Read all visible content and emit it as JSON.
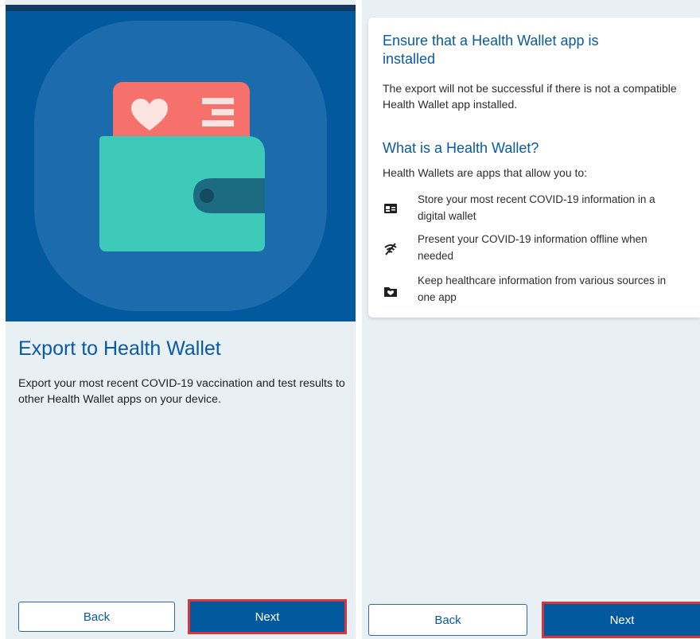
{
  "left_screen": {
    "title": "Export to Health Wallet",
    "description": "Export your most recent COVID-19 vaccination and test results to other Health Wallet apps on your device.",
    "back_label": "Back",
    "next_label": "Next"
  },
  "right_screen": {
    "ensure_heading": "Ensure that a Health Wallet app is installed",
    "ensure_text": "The export will not be successful if there is not a compatible Health Wallet app installed.",
    "what_heading": "What is a Health Wallet?",
    "intro": "Health Wallets are apps that allow you to:",
    "items": [
      {
        "icon": "id-card-icon",
        "text": "Store your most recent COVID-19 information in a digital wallet"
      },
      {
        "icon": "wifi-off-icon",
        "text": "Present your COVID-19 information offline when needed"
      },
      {
        "icon": "medical-folder-icon",
        "text": "Keep healthcare information from various sources in one app"
      }
    ],
    "back_label": "Back",
    "next_label": "Next"
  },
  "colors": {
    "primary": "#03599d",
    "hero_circle": "#1c6cad",
    "wallet": "#3dcab8",
    "card_red": "#f6716c",
    "highlight_border": "#d9353a",
    "background": "#e9f0f4"
  }
}
